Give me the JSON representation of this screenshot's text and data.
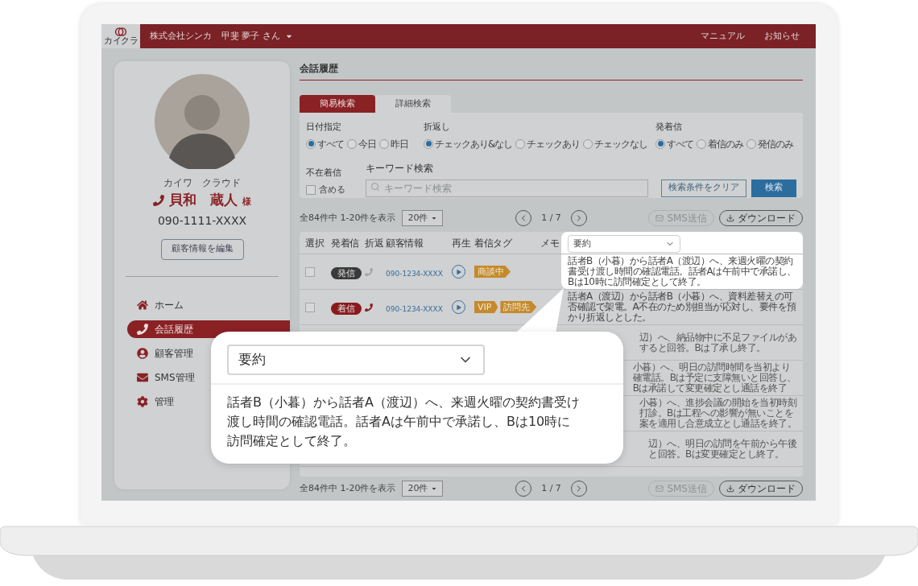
{
  "header": {
    "logo_text": "カイクラ",
    "company": "株式会社シンカ",
    "user": "甲斐 夢子 さん",
    "links": [
      "マニュアル",
      "お知らせ"
    ]
  },
  "customer": {
    "kana": "カイワ　クラウド",
    "name": "貝和　蔵人",
    "honorific": "様",
    "phone": "090-1111-XXXX",
    "edit_button": "顧客情報を編集"
  },
  "nav": [
    {
      "label": "ホーム",
      "kind": "home",
      "selected": false
    },
    {
      "label": "会話履歴",
      "kind": "phone",
      "selected": true
    },
    {
      "label": "顧客管理",
      "kind": "user",
      "selected": false
    },
    {
      "label": "SMS管理",
      "kind": "mail",
      "selected": false
    },
    {
      "label": "管理",
      "kind": "gear",
      "selected": false
    }
  ],
  "page_title": "会話履歴",
  "search_tabs": [
    {
      "label": "簡易検索",
      "selected": true
    },
    {
      "label": "詳細検索",
      "selected": false
    }
  ],
  "filters": [
    {
      "label": "日付指定",
      "options": [
        {
          "label": "すべて",
          "selected": true
        },
        {
          "label": "今日",
          "selected": false
        },
        {
          "label": "昨日",
          "selected": false
        }
      ]
    },
    {
      "label": "折返し",
      "options": [
        {
          "label": "チェックあり&なし",
          "selected": true
        },
        {
          "label": "チェックあり",
          "selected": false
        },
        {
          "label": "チェックなし",
          "selected": false
        }
      ]
    },
    {
      "label": "発着信",
      "options": [
        {
          "label": "すべて",
          "selected": true
        },
        {
          "label": "着信のみ",
          "selected": false
        },
        {
          "label": "発信のみ",
          "selected": false
        }
      ]
    }
  ],
  "missed_calls": {
    "label": "不在着信",
    "option": "含める",
    "checked": false
  },
  "keyword": {
    "label": "キーワード検索",
    "placeholder": "キーワード検索"
  },
  "buttons": [
    {
      "label": "検索条件をクリア",
      "kind": "secondary"
    },
    {
      "label": "検索",
      "kind": "primary"
    }
  ],
  "pagination": [
    {
      "summary": "全84件中 1-20件を表示",
      "per_page": "20件",
      "page": "1 / 7",
      "actions": [
        {
          "label": "SMS送信",
          "kind": "sms",
          "disabled": true
        },
        {
          "label": "ダウンロード",
          "kind": "download",
          "disabled": false
        }
      ]
    },
    {
      "summary": "全84件中 1-20件を表示",
      "per_page": "20件",
      "page": "1 / 7",
      "actions": [
        {
          "label": "SMS送信",
          "kind": "sms",
          "disabled": true
        },
        {
          "label": "ダウンロード",
          "kind": "download",
          "disabled": false
        }
      ]
    }
  ],
  "table": {
    "columns": [
      "選択",
      "発着信",
      "折返",
      "顧客情報",
      "再生",
      "着信タグ",
      "メモ"
    ],
    "summary_column": {
      "select": "要約",
      "highlighted": true
    },
    "rows": [
      {
        "checked": false,
        "direction": {
          "label": "発信",
          "kind": "outgoing"
        },
        "callback": false,
        "phone": "090-1234-XXXX",
        "tags": [
          {
            "label": "商談中"
          }
        ],
        "memo": "話者B（小暮）から話者A（渡辺）へ、来週火曜の契約書受け渡し時間の確認電話。話者Aは午前中で承諾し、Bは10時に訪問確定として終了。",
        "highlighted": true
      },
      {
        "checked": false,
        "direction": {
          "label": "着信",
          "kind": "incoming"
        },
        "callback": true,
        "phone": "090-1234-XXXX",
        "tags": [
          {
            "label": "VIP"
          },
          {
            "label": "訪問先"
          }
        ],
        "memo": "話者A（渡辺）から話者B（小暮）へ、資料差替えの可否確認で架電。A不在のため別担当が応対し、要件を預かり折返しとした。",
        "highlighted": false
      },
      {
        "memo_lines": [
          "辺）へ、納品物中に不足ファイルがあ",
          "すると回答。Bは了承し終了。"
        ],
        "highlighted": false
      },
      {
        "memo_lines": [
          "小暮）へ、明日の訪問時間を当初より",
          "確電話。Bは予定に支障無いと回答し、",
          "Bは承諾して変更確定とし通話を終了"
        ],
        "highlighted": false
      },
      {
        "memo_lines": [
          "小暮）へ、進捗会議の開始を当初時刻",
          "打診。Bは工程への影響が無いことを",
          "案を適用し合意成立とし通話を終了。"
        ],
        "highlighted": false
      },
      {
        "memo_lines": [
          "辺）へ、明日の訪問を午前から午後",
          "と回答。Bは変更確定とし終了。"
        ],
        "highlighted": false
      }
    ]
  },
  "callout": {
    "select": "要約",
    "text": "話者B（小暮）から話者A（渡辺）へ、来週火曜の契約書受け渡し時間の確認電話。話者Aは午前中で承諾し、Bは10時に訪問確定として終了。"
  }
}
